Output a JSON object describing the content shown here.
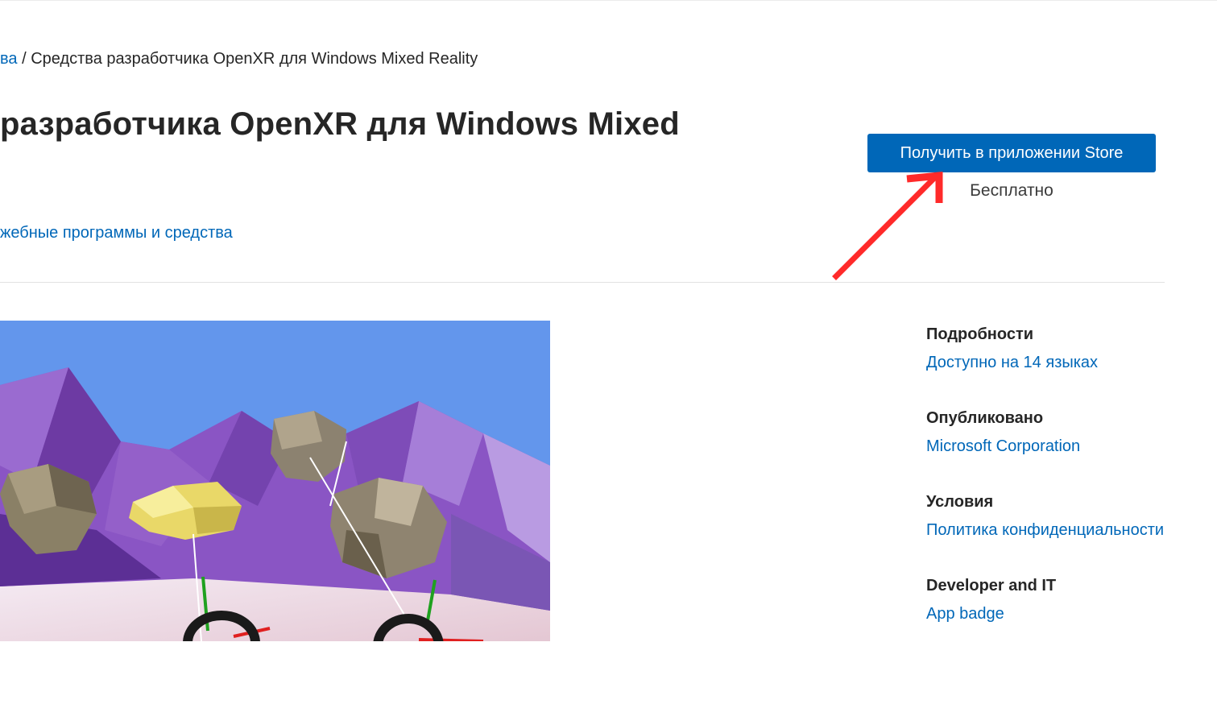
{
  "breadcrumb": {
    "link_label": "ва",
    "separator": "/",
    "current": "Средства разработчика OpenXR для Windows Mixed Reality"
  },
  "page_title": "разработчика OpenXR для Windows Mixed",
  "category_link": "жебные программы и средства",
  "store": {
    "button_label": "Получить в приложении Store",
    "price": "Бесплатно"
  },
  "details": [
    {
      "heading": "Подробности",
      "links": [
        "Доступно на 14 языках"
      ]
    },
    {
      "heading": "Опубликовано",
      "links": [
        "Microsoft Corporation"
      ]
    },
    {
      "heading": "Условия",
      "links": [
        "Политика конфиденциальности"
      ]
    },
    {
      "heading": "Developer and IT",
      "links": [
        "App badge"
      ]
    }
  ],
  "colors": {
    "accent": "#0067b8",
    "annotation_arrow": "#ff2a2a"
  },
  "icons": {
    "annotation": "red-arrow-icon"
  }
}
